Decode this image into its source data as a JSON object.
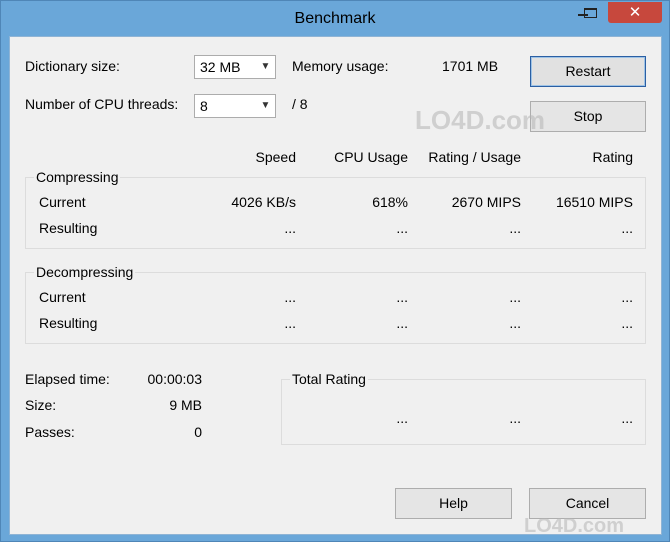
{
  "window": {
    "title": "Benchmark",
    "close_glyph": "✕"
  },
  "controls": {
    "dict_label": "Dictionary size:",
    "dict_value": "32 MB",
    "threads_label": "Number of CPU threads:",
    "threads_value": "8",
    "threads_max": "/ 8",
    "mem_label": "Memory usage:",
    "mem_value": "1701 MB",
    "restart": "Restart",
    "stop": "Stop"
  },
  "headers": {
    "speed": "Speed",
    "cpu": "CPU Usage",
    "rating_usage": "Rating / Usage",
    "rating": "Rating"
  },
  "compressing": {
    "title": "Compressing",
    "current": {
      "label": "Current",
      "speed": "4026 KB/s",
      "cpu": "618%",
      "rating_usage": "2670 MIPS",
      "rating": "16510 MIPS"
    },
    "resulting": {
      "label": "Resulting",
      "speed": "...",
      "cpu": "...",
      "rating_usage": "...",
      "rating": "..."
    }
  },
  "decompressing": {
    "title": "Decompressing",
    "current": {
      "label": "Current",
      "speed": "...",
      "cpu": "...",
      "rating_usage": "...",
      "rating": "..."
    },
    "resulting": {
      "label": "Resulting",
      "speed": "...",
      "cpu": "...",
      "rating_usage": "...",
      "rating": "..."
    }
  },
  "stats": {
    "elapsed_label": "Elapsed time:",
    "elapsed": "00:00:03",
    "size_label": "Size:",
    "size": "9 MB",
    "passes_label": "Passes:",
    "passes": "0"
  },
  "total": {
    "title": "Total Rating",
    "c1": "...",
    "c2": "...",
    "c3": "..."
  },
  "footer": {
    "help": "Help",
    "cancel": "Cancel"
  },
  "watermark": "LO4D.com"
}
